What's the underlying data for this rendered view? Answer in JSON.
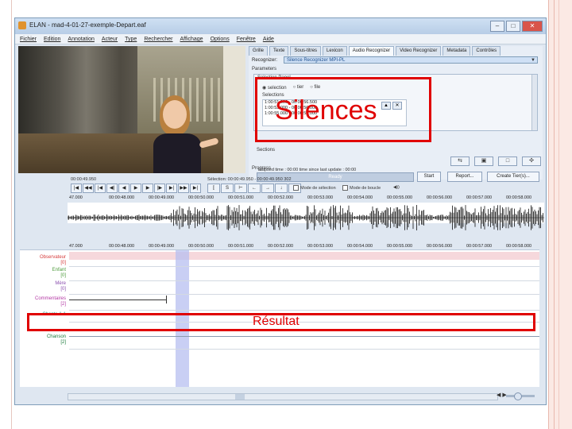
{
  "window": {
    "title": "ELAN - mad-4-01-27-exemple-Depart.eaf",
    "controls": [
      "–",
      "□",
      "✕"
    ]
  },
  "menu": [
    "Fichier",
    "Edition",
    "Annotation",
    "Acteur",
    "Type",
    "Rechercher",
    "Affichage",
    "Options",
    "Fenêtre",
    "Aide"
  ],
  "tabs": [
    "Grille",
    "Texte",
    "Sous-titres",
    "Lexicon",
    "Audio Recognizer",
    "Video Recognizer",
    "Metadata",
    "Contrôles"
  ],
  "recognizer": {
    "label": "Recognizer:",
    "value": "Silence Recognizer MPI-PL",
    "parameters_label": "Parameters",
    "selection_panel_label": "Selection Panel",
    "radio_selection": "selection",
    "radio_tier": "tier",
    "radio_file": "file",
    "selections_label": "Selections",
    "selections": [
      "1:00:51.000 - 00:00:56.500",
      "1:00:53.000 - 00:00:56.000",
      "1:00:55.000 - 00:00:57.000"
    ],
    "tiers_label": "Sections"
  },
  "progress": {
    "label": "Progress",
    "status": "Ready",
    "elapsed": "Elapsed time :   00:00      time since last update :   00:00"
  },
  "actions": {
    "start": "Start",
    "report": "Report...",
    "create_tiers": "Create Tier(s)..."
  },
  "playback": {
    "time": "00:00:49.950",
    "selection_info": "Sélection: 00:00:49.950 - 00:00:49.950  302",
    "media_selection_label": "Mode de sélection",
    "loop_label": "Mode de boucle"
  },
  "ruler_ticks": [
    "47.000",
    "00:00:48.000",
    "00:00:49.000",
    "00:00:50.000",
    "00:00:51.000",
    "00:00:52.000",
    "00:00:53.000",
    "00:00:54.000",
    "00:00:55.000",
    "00:00:56.000",
    "00:00:57.000",
    "00:00:58.000"
  ],
  "tiers": [
    {
      "name": "Observateur",
      "count": "[0]",
      "color": "#d63c3c"
    },
    {
      "name": "Enfant",
      "count": "[0]",
      "color": "#4c9a3a"
    },
    {
      "name": "Mère",
      "count": "[0]",
      "color": "#8b4faf"
    },
    {
      "name": "Commentaires",
      "count": "[2]",
      "color": "#b43aa5"
    },
    {
      "name": "Chants-1-1",
      "count": "",
      "color": "#2f9a8f"
    },
    {
      "name": "Chanson",
      "count": "[2]",
      "color": "#1b7a3a"
    }
  ],
  "annotations": {
    "silences": "Silences",
    "resultat": "Résultat"
  }
}
